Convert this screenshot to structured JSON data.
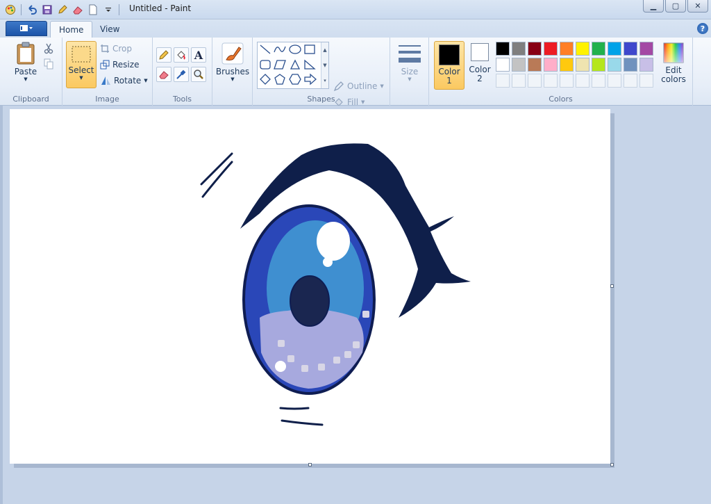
{
  "window": {
    "title": "Untitled - Paint"
  },
  "tabs": [
    {
      "label": "Home",
      "active": true
    },
    {
      "label": "View",
      "active": false
    }
  ],
  "groups": {
    "clipboard": {
      "label": "Clipboard",
      "paste": "Paste"
    },
    "image": {
      "label": "Image",
      "select": "Select",
      "crop": "Crop",
      "resize": "Resize",
      "rotate": "Rotate"
    },
    "tools": {
      "label": "Tools"
    },
    "brushes": {
      "label": "Brushes"
    },
    "shapes": {
      "label": "Shapes",
      "outline": "Outline",
      "fill": "Fill"
    },
    "size": {
      "label": "Size"
    },
    "colors": {
      "label": "Colors",
      "color1": "Color 1",
      "color2": "Color 2",
      "edit": "Edit colors",
      "color1_value": "#000000",
      "color2_value": "#ffffff",
      "swatches_row1": [
        "#000000",
        "#7f7f7f",
        "#880015",
        "#ed1c24",
        "#ff7f27",
        "#fff200",
        "#22b14c",
        "#00a2e8",
        "#3f48cc",
        "#a349a4"
      ],
      "swatches_row2": [
        "#ffffff",
        "#c3c3c3",
        "#b97a57",
        "#ffaec9",
        "#ffc90e",
        "#efe4b0",
        "#b5e61d",
        "#99d9ea",
        "#7092be",
        "#c8bfe7"
      ]
    }
  },
  "drawing": {
    "description_colors": {
      "iris_outer": "#2a47b8",
      "iris_mid": "#3f8fd0",
      "iris_lower": "#a7a9de",
      "pupil": "#1a2650",
      "lash": "#0f1f4a",
      "outline": "#0f1d52"
    }
  }
}
